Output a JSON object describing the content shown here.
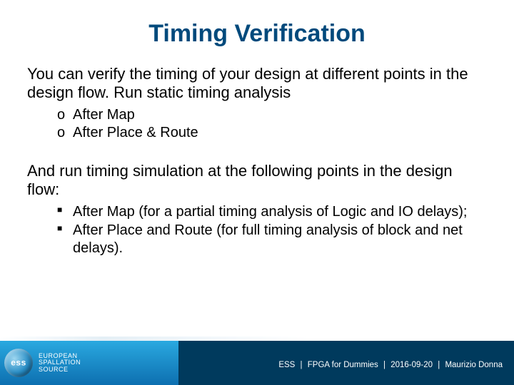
{
  "title": "Timing Verification",
  "intro1": "You can verify the timing of your design at different points in the design flow. Run static timing analysis",
  "list1": [
    "After Map",
    "After Place & Route"
  ],
  "intro2": "And run timing simulation at the following points in the design flow:",
  "list2": [
    "After Map (for a partial timing analysis of Logic and IO delays);",
    "After Place and Route (for full timing analysis of block and net delays)."
  ],
  "footer": {
    "logo_initials": "ess",
    "logo_line1": "European",
    "logo_line2": "Spallation",
    "logo_line3": "Source",
    "org": "ESS",
    "doc": "FPGA for Dummies",
    "date": "2016-09-20",
    "author": "Maurizio Donna"
  }
}
